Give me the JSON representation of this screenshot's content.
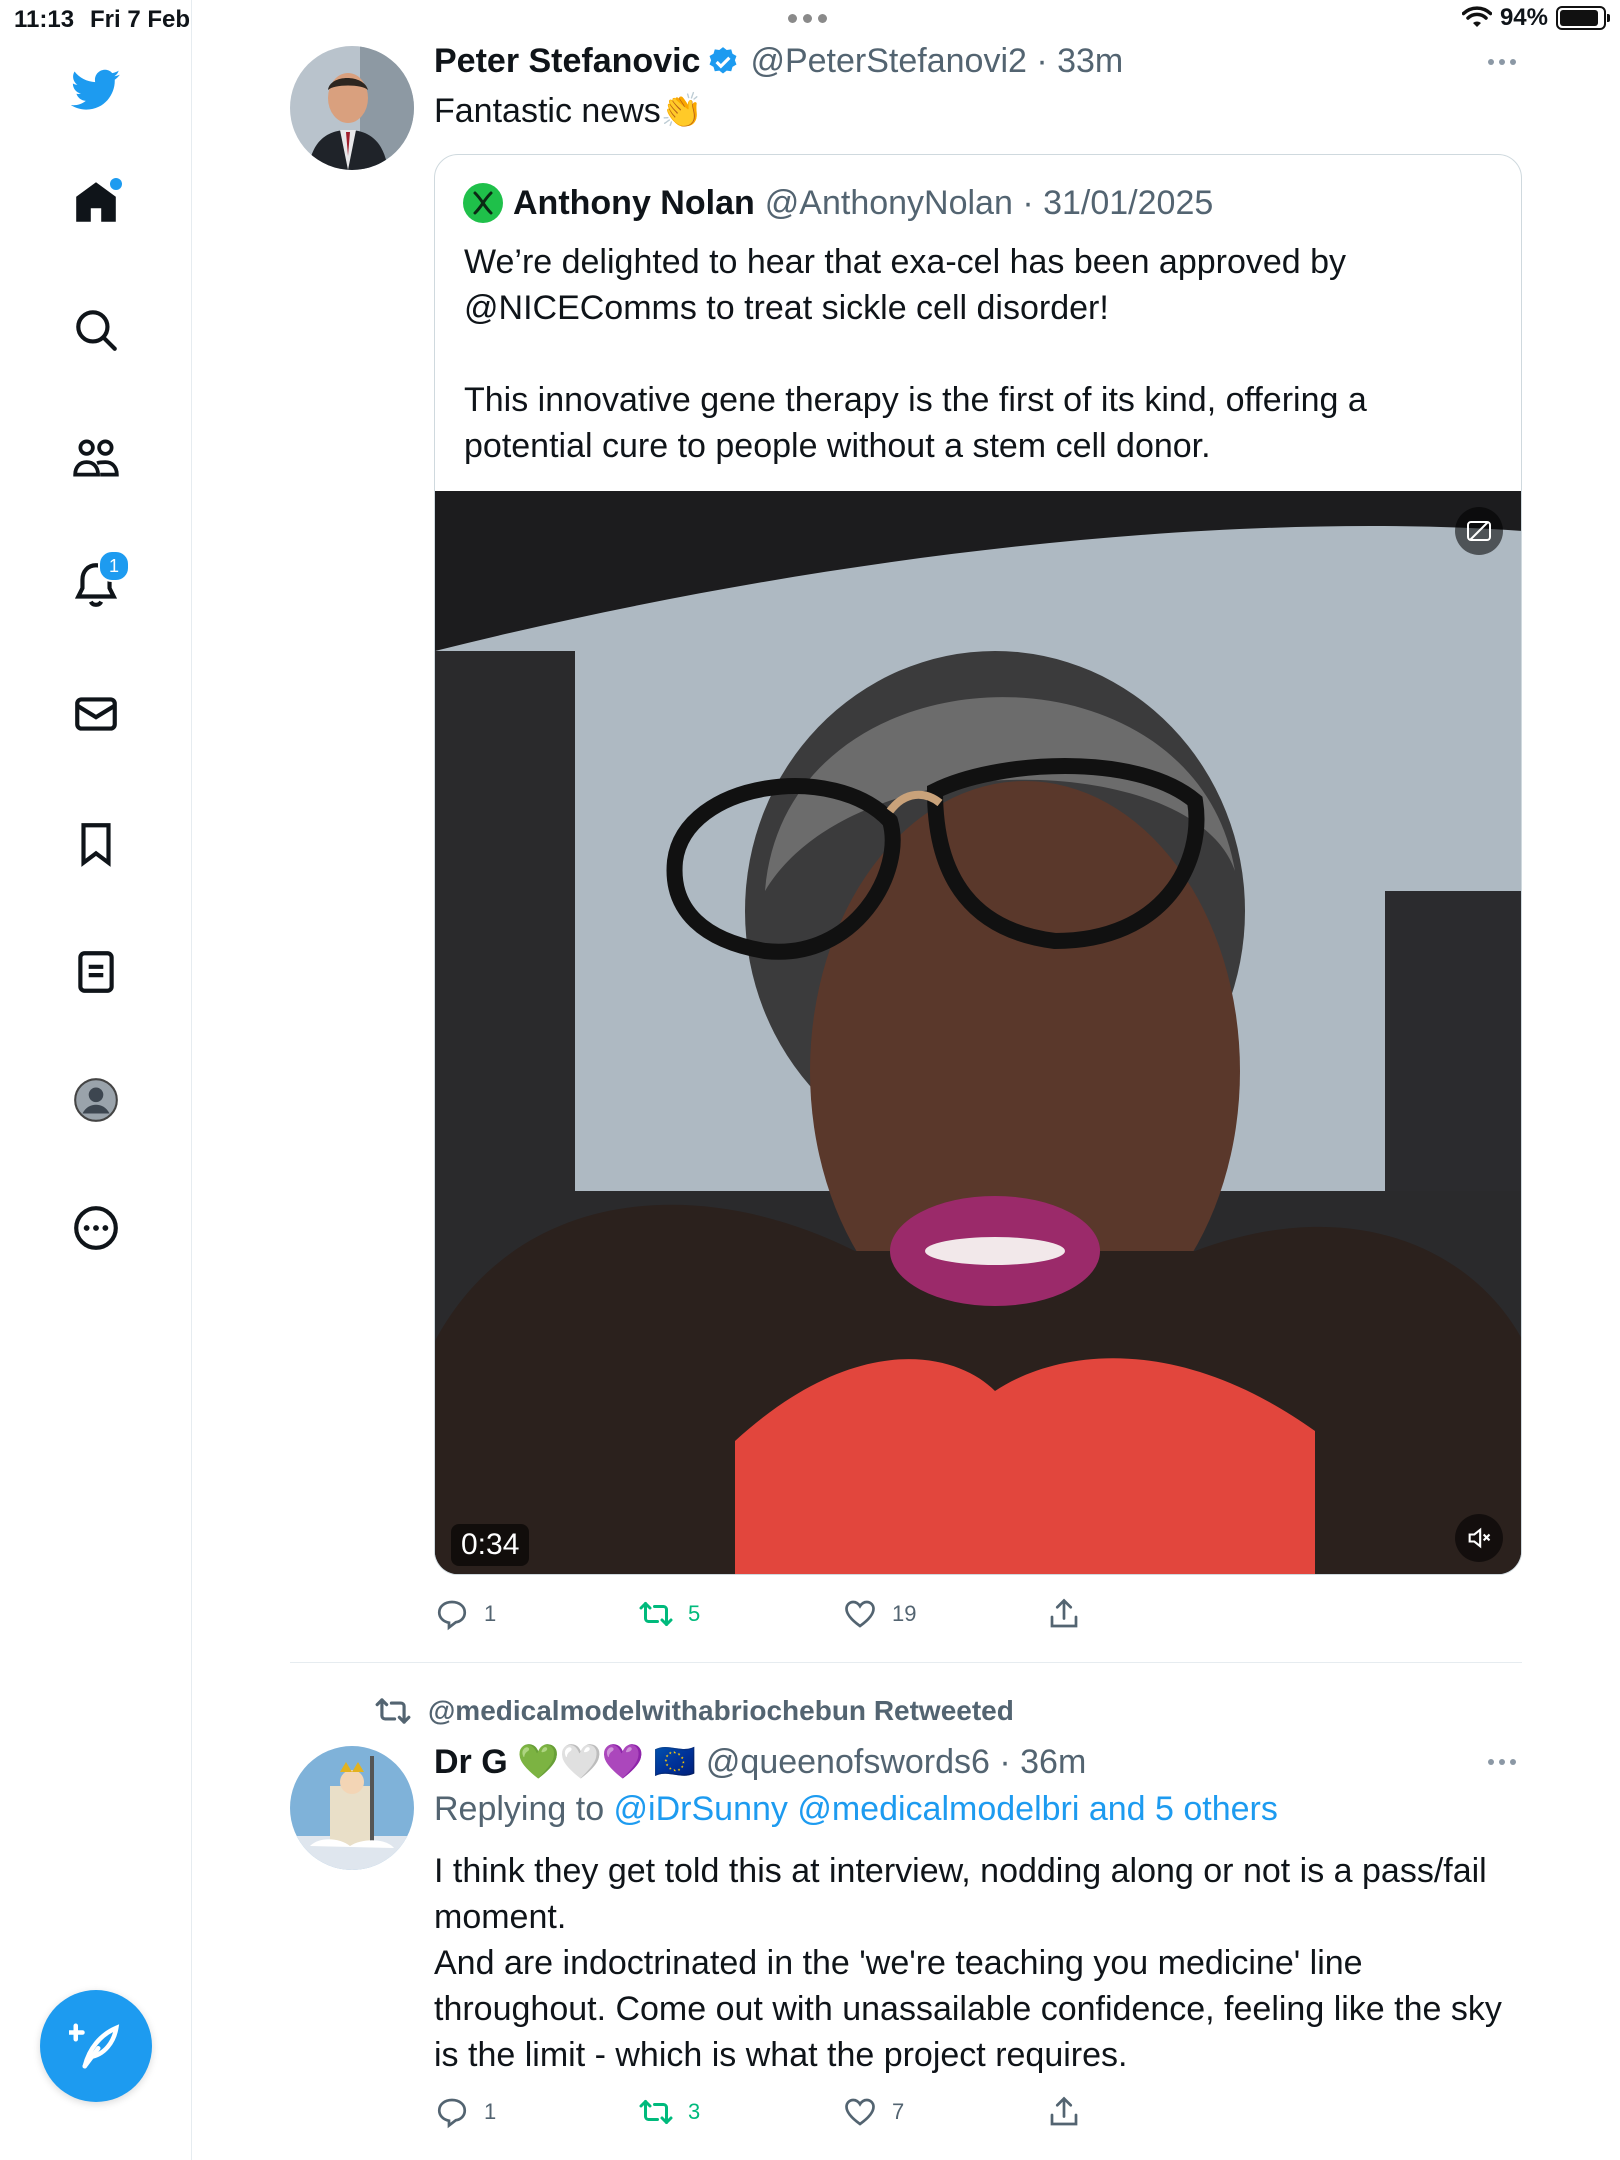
{
  "status_bar": {
    "time": "11:13",
    "date": "Fri 7 Feb",
    "battery": "94%"
  },
  "sidebar": {
    "items": [
      {
        "name": "twitter-logo"
      },
      {
        "name": "home"
      },
      {
        "name": "explore"
      },
      {
        "name": "communities"
      },
      {
        "name": "notifications",
        "badge": "1"
      },
      {
        "name": "messages"
      },
      {
        "name": "bookmarks"
      },
      {
        "name": "lists"
      },
      {
        "name": "profile"
      },
      {
        "name": "more"
      }
    ],
    "accent": "#1d9bf0"
  },
  "tweet1": {
    "name": "Peter Stefanovic",
    "handle": "@PeterStefanovi2 · 33m",
    "verified": true,
    "text": "Fantastic news👏",
    "quote": {
      "name": "Anthony Nolan",
      "handle": "@AnthonyNolan · 31/01/2025",
      "text": "We’re delighted to hear that exa-cel has been approved by @NICEComms to treat sickle cell disorder!\n\nThis innovative gene therapy is the first of its kind, offering a potential cure to people without a stem cell donor.",
      "video_duration": "0:34"
    },
    "replies": "1",
    "retweets": "5",
    "likes": "19"
  },
  "tweet2": {
    "retweeted_by": "@medicalmodelwithabriochebun Retweeted",
    "name": "Dr G 💚🤍💜 🇪🇺",
    "handle": "@queenofswords6 · 36m",
    "replying_prefix": "Replying to ",
    "replying_to": "@iDrSunny @medicalmodelbri and 5 others",
    "text": "I think they get told this at interview, nodding along or not is a pass/fail moment.\nAnd are indoctrinated in the 'we're teaching you medicine' line throughout. Come out with unassailable confidence, feeling like the sky is the limit - which is what the project requires.",
    "replies": "1",
    "retweets": "3",
    "likes": "7"
  },
  "colors": {
    "retweet_green": "#00ba7c",
    "muted_gray": "#536471"
  }
}
